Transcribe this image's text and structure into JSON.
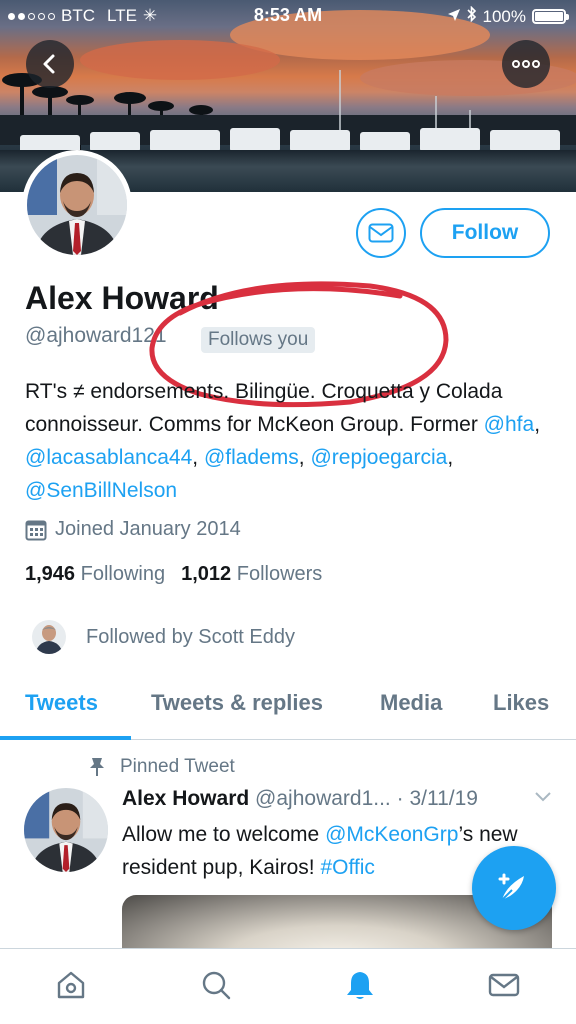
{
  "status_bar": {
    "carrier": "BTC",
    "network": "LTE",
    "time": "8:53 AM",
    "battery": "100%"
  },
  "profile": {
    "name": "Alex Howard",
    "handle": "@ajhoward121",
    "follows_you": "Follows you",
    "bio_parts": [
      "RT's ≠ endorsements. Bilingüe. Croquetta y Colada connoisseur. Comms for McKeon Group. Former ",
      "@hfa",
      ", ",
      "@lacasablanca44",
      ", ",
      "@fladems",
      ", ",
      "@repjoegarcia",
      ", ",
      "@SenBillNelson"
    ],
    "joined": "Joined January 2014",
    "following_count": "1,946",
    "following_label": "Following",
    "followers_count": "1,012",
    "followers_label": "Followers",
    "followed_by": "Followed by Scott Eddy",
    "follow_label": "Follow"
  },
  "tabs": [
    {
      "label": "Tweets",
      "active": true
    },
    {
      "label": "Tweets & replies",
      "active": false
    },
    {
      "label": "Media",
      "active": false
    },
    {
      "label": "Likes",
      "active": false
    }
  ],
  "tweet": {
    "pinned_label": "Pinned Tweet",
    "author_name": "Alex Howard",
    "author_handle": "@ajhoward1...",
    "date": "· 3/11/19",
    "text_parts": [
      "Allow me to welcome ",
      "@McKeonGrp",
      "’s new resident pup, Kairos! ",
      "#Offic"
    ]
  },
  "icons": {
    "back": "back-arrow-icon",
    "more": "more-dots-icon",
    "message": "envelope-icon",
    "calendar": "calendar-icon",
    "pin": "pin-icon",
    "chevron": "chevron-down-icon",
    "compose": "compose-tweet-icon",
    "home": "home-icon",
    "search": "search-icon",
    "notifications": "bell-icon",
    "messages": "mail-icon"
  },
  "colors": {
    "accent": "#1da1f2",
    "text": "#14171a",
    "muted": "#657786",
    "annotation": "#d9303f"
  }
}
